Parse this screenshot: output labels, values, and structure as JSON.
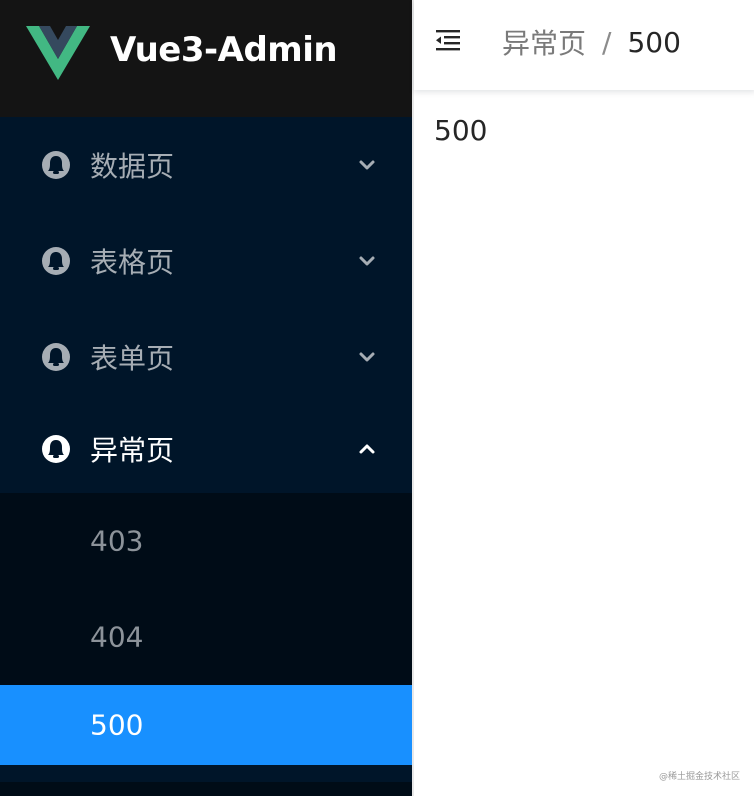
{
  "app": {
    "logo_text": "Vue3-Admin",
    "colors": {
      "sidebar_bg": "#001529",
      "logo_bar_bg": "#141414",
      "submenu_bg": "#000c17",
      "accent": "#1890ff",
      "vue_green": "#42b883",
      "vue_dark": "#35495e"
    }
  },
  "sidebar": {
    "menus": [
      {
        "label": "数据页",
        "icon": "user-icon",
        "arrow": "chevron-down-icon"
      },
      {
        "label": "表格页",
        "icon": "user-icon",
        "arrow": "chevron-down-icon"
      },
      {
        "label": "表单页",
        "icon": "user-icon",
        "arrow": "chevron-down-icon"
      },
      {
        "label": "异常页",
        "icon": "user-icon",
        "arrow": "chevron-up-icon",
        "open": true
      }
    ],
    "submenu": [
      {
        "label": "403"
      },
      {
        "label": "404"
      },
      {
        "label": "500",
        "active": true
      }
    ]
  },
  "header": {
    "collapse_icon": "menu-fold-icon",
    "breadcrumb": {
      "parent": "异常页",
      "separator": "/",
      "current": "500"
    }
  },
  "main": {
    "content": "500"
  },
  "watermark": "@稀土掘金技术社区"
}
